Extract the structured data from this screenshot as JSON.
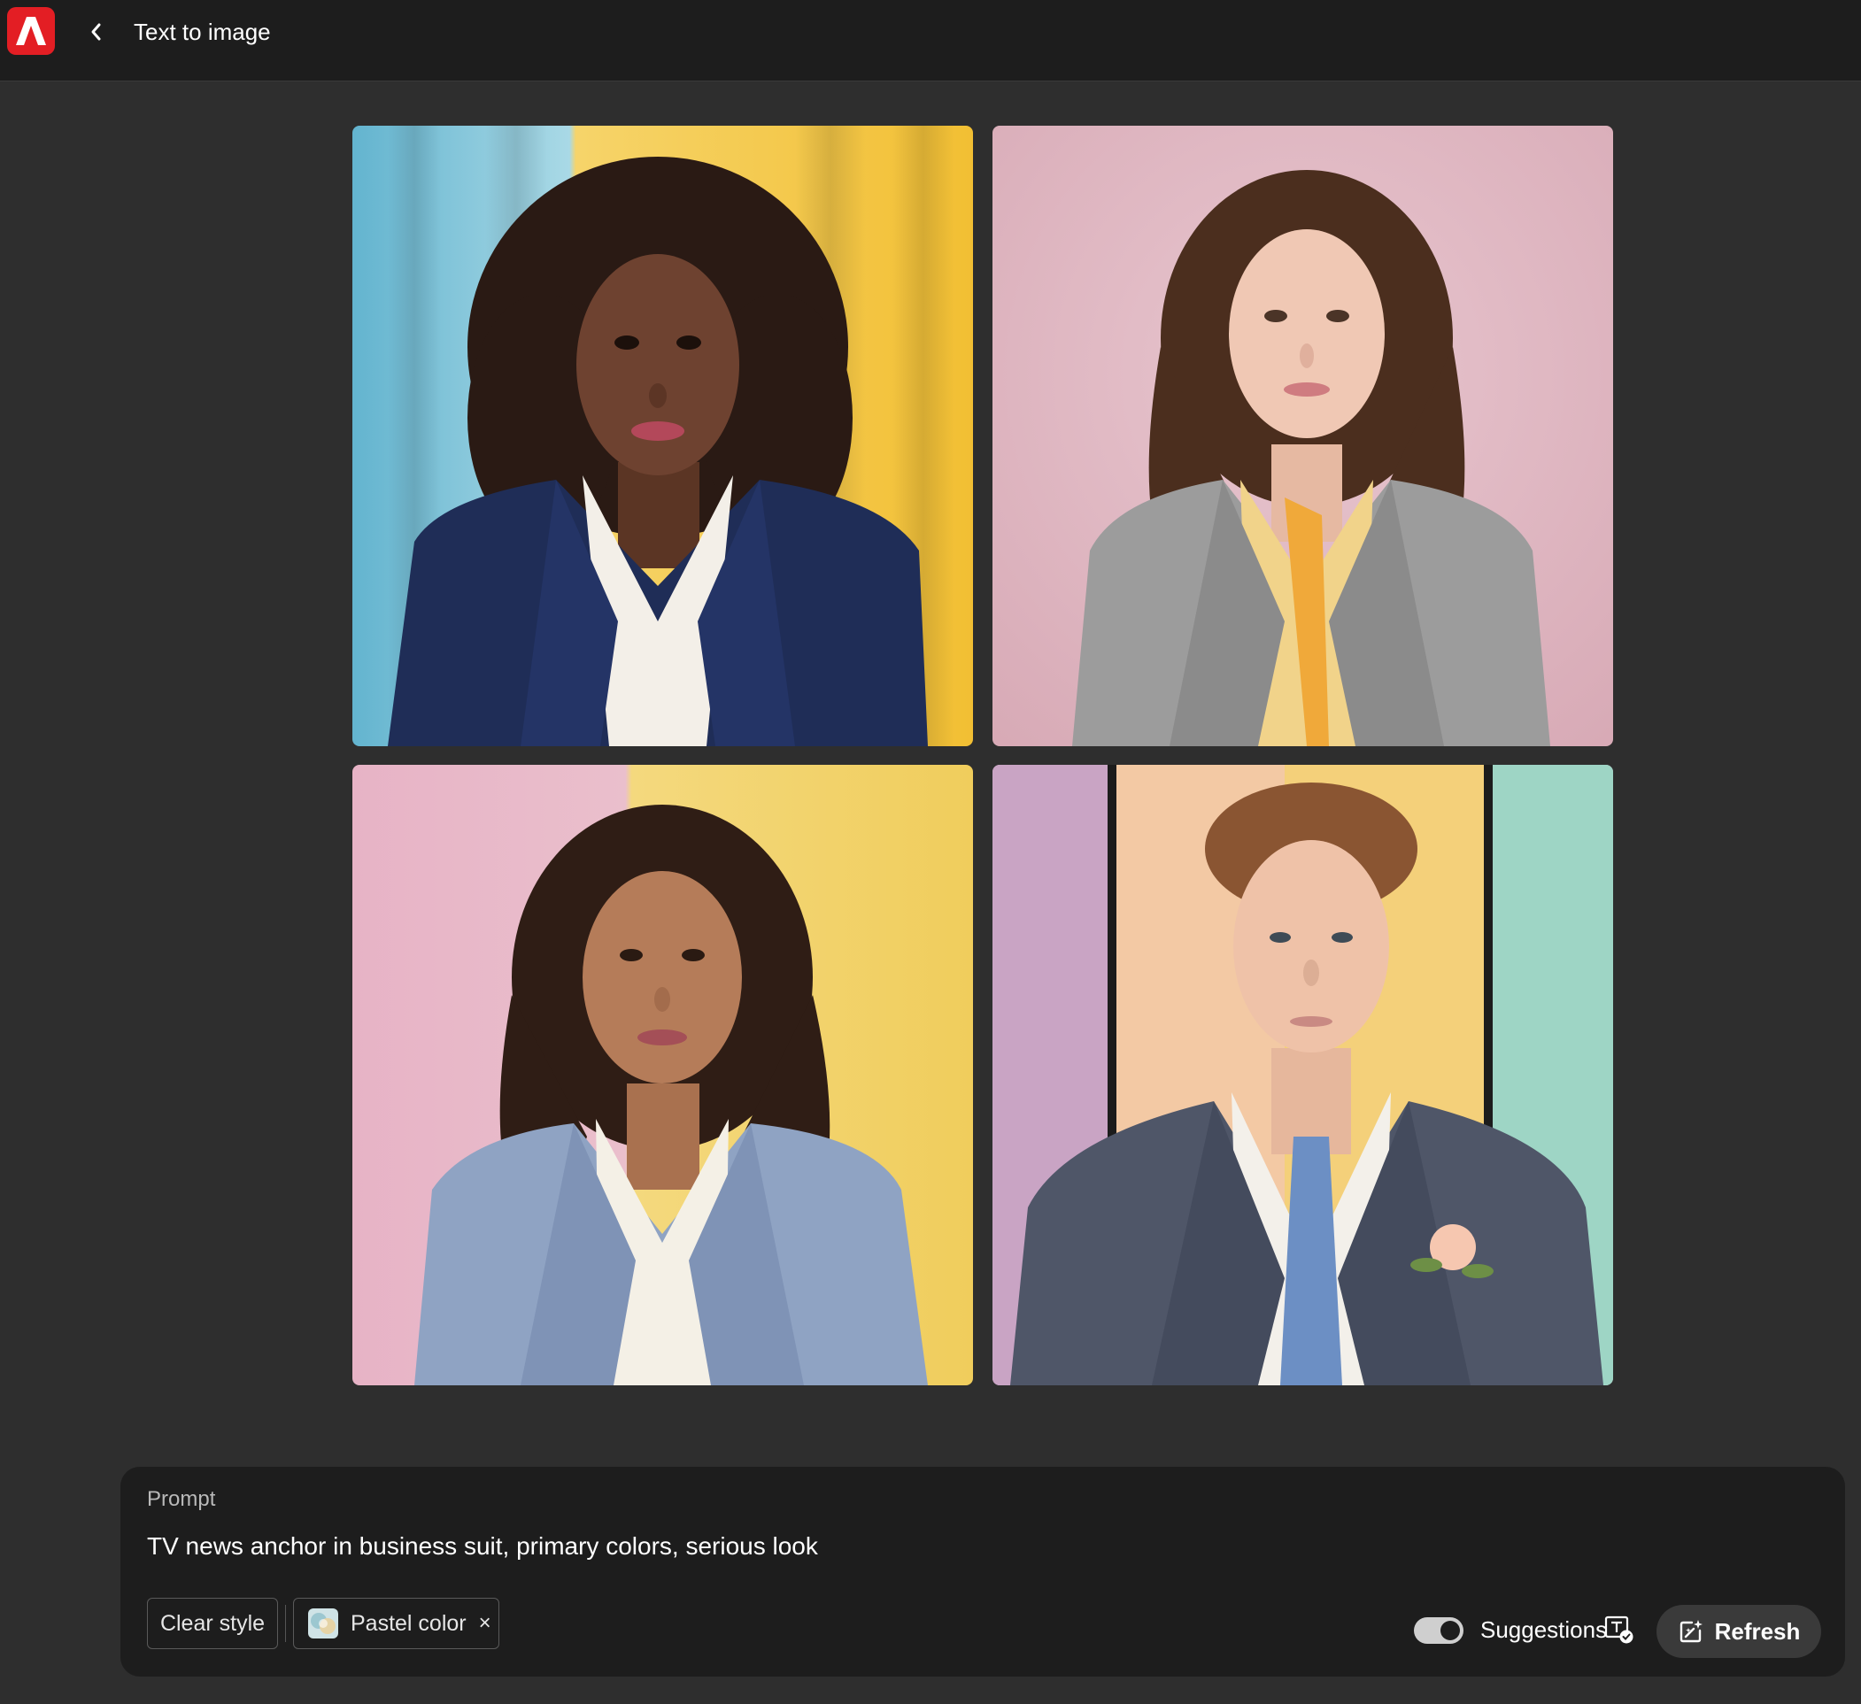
{
  "app": {
    "title": "Text to image",
    "brand_color": "#e31e24"
  },
  "icons": {
    "logo": "adobe-logo-icon",
    "back": "chevron-left-icon",
    "suggestions": "text-suggestion-icon",
    "refresh": "sparkle-refresh-icon",
    "close": "close-icon"
  },
  "images": [
    {
      "subject": "woman with curly hair in navy blazer",
      "background": [
        "#8ecfe0",
        "#f3c94a"
      ]
    },
    {
      "subject": "woman with long wavy hair in grey plaid blazer",
      "background": [
        "#e2bcc6",
        "#d9aeb8"
      ]
    },
    {
      "subject": "woman with wavy hair in light blue blazer",
      "background": [
        "#e8b7c9",
        "#f1d16a"
      ]
    },
    {
      "subject": "man in grey suit with striped tie and boutonniere",
      "background": [
        "#d4a8c6",
        "#f4cf74",
        "#9fd6c4"
      ]
    }
  ],
  "prompt": {
    "label": "Prompt",
    "text": "TV news anchor in business suit, primary colors, serious look"
  },
  "style": {
    "clear_label": "Clear style",
    "applied_label": "Pastel color",
    "close_glyph": "×"
  },
  "suggestions": {
    "label": "Suggestions",
    "enabled": true
  },
  "refresh": {
    "label": "Refresh"
  }
}
